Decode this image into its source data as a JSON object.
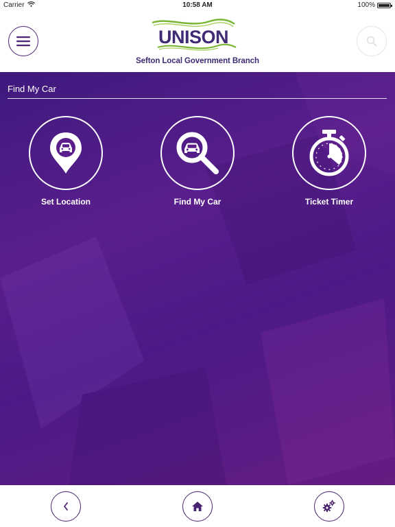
{
  "status_bar": {
    "carrier": "Carrier",
    "time": "10:58 AM",
    "battery": "100%",
    "battery_level": 1.0
  },
  "header": {
    "logo_text": "UNISON",
    "branch_name": "Sefton Local Government Branch",
    "menu_icon": "hamburger-menu-icon",
    "search_icon": "search-icon"
  },
  "section": {
    "title": "Find My Car"
  },
  "tiles": [
    {
      "label": "Set Location",
      "icon": "car-location-pin-icon"
    },
    {
      "label": "Find My Car",
      "icon": "car-magnifier-icon"
    },
    {
      "label": "Ticket Timer",
      "icon": "stopwatch-icon"
    }
  ],
  "bottom_nav": {
    "back_icon": "chevron-left-icon",
    "home_icon": "home-icon",
    "settings_icon": "gears-icon"
  },
  "colors": {
    "brand_purple": "#4a2370",
    "branch_text": "#3f2a73",
    "logo_green": "#7ab534",
    "background_start": "#3e1a7d",
    "background_end": "#651c83"
  }
}
